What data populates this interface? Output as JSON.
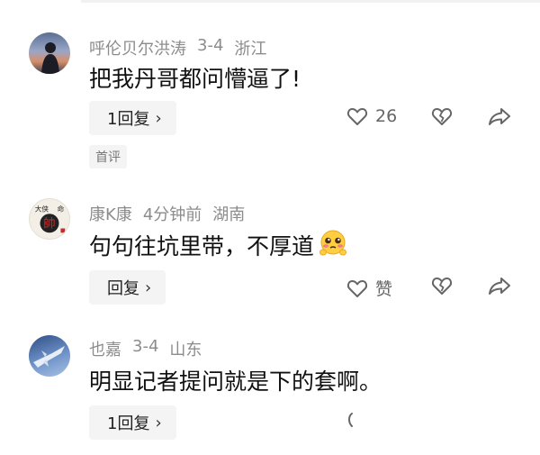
{
  "comments": [
    {
      "author": "呼伦贝尔洪涛",
      "date": "3-4",
      "region": "浙江",
      "text": "把我丹哥都问懵逼了!",
      "reply_label": "1回复",
      "like_count": "26",
      "tag": "首评",
      "avatar_icon": "person-sunset-avatar"
    },
    {
      "author": "康K康",
      "date": "4分钟前",
      "region": "湖南",
      "text": "句句往坑里带，不厚道",
      "emoji_icon": "pleading-face-emoji",
      "reply_label": "回复",
      "like_label": "赞",
      "avatar_icon": "calligraphy-shuai-avatar",
      "avatar_text": "大侠 帥 命"
    },
    {
      "author": "也嘉",
      "date": "3-4",
      "region": "山东",
      "text": "明显记者提问就是下的套啊。",
      "reply_label": "1回复",
      "avatar_icon": "fighter-jet-avatar"
    }
  ],
  "colors": {
    "meta_text": "#8c8c8c",
    "body_text": "#111111",
    "button_bg": "#f4f4f4",
    "icon_gray": "#666666"
  }
}
